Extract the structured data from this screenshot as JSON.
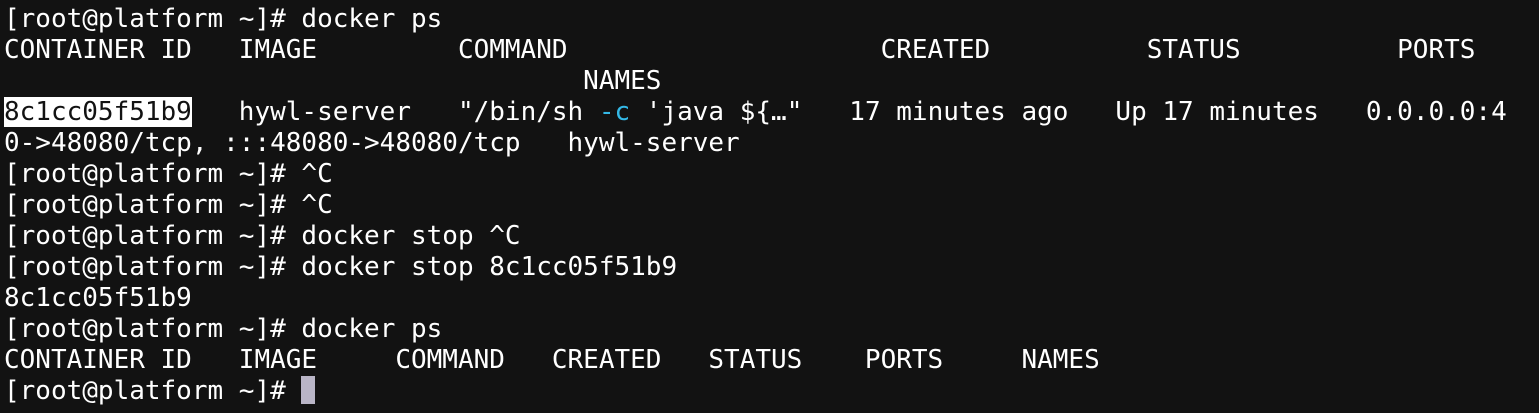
{
  "prompt": "[root@platform ~]# ",
  "colors": {
    "background": "#121212",
    "foreground": "#ffffff",
    "selection_bg": "#ffffff",
    "flag": "#34b8e6",
    "cursor": "#b9b5c7"
  },
  "lines": {
    "l1_cmd": "docker ps",
    "l2": "CONTAINER ID   IMAGE         COMMAND                    CREATED          STATUS          PORTS",
    "l3": "                                     NAMES",
    "l4_id": "8c1cc05f51b9",
    "l4_a": "   hywl-server   \"/bin/sh ",
    "l4_flag": "-c",
    "l4_b": " 'java ${…\"   17 minutes ago   Up 17 minutes   0.0.0.0:4",
    "l5": "0->48080/tcp, :::48080->48080/tcp   hywl-server",
    "l6_cmd": "^C",
    "l7_cmd": "^C",
    "l8_cmd": "docker stop ^C",
    "l9_cmd": "docker stop 8c1cc05f51b9",
    "l10": "8c1cc05f51b9",
    "l11_cmd": "docker ps",
    "l12": "CONTAINER ID   IMAGE     COMMAND   CREATED   STATUS    PORTS     NAMES",
    "l13_cmd": ""
  }
}
